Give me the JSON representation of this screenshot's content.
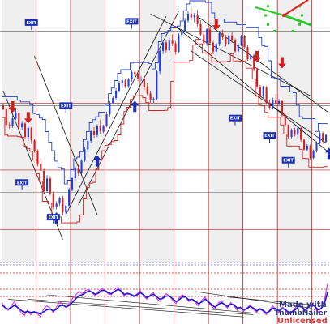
{
  "chart_data": {
    "type": "candlestick",
    "title": "",
    "xlabel": "",
    "ylabel": "",
    "grid": true,
    "panels": {
      "price": {
        "ylim": [
          0,
          100
        ]
      },
      "oscillator": {
        "ylim": [
          0,
          100
        ]
      }
    },
    "candles": [
      [
        60.0,
        60.6,
        58.2,
        58.8
      ],
      [
        58.8,
        59.2,
        51.1,
        52.2
      ],
      [
        52.2,
        53.2,
        50.7,
        51.7
      ],
      [
        51.7,
        56.1,
        51.0,
        54.8
      ],
      [
        54.8,
        58.5,
        54.2,
        57.2
      ],
      [
        57.2,
        57.4,
        50.5,
        51.3
      ],
      [
        51.3,
        53.8,
        50.3,
        52.8
      ],
      [
        52.8,
        53.4,
        46.6,
        47.4
      ],
      [
        47.4,
        52.0,
        45.7,
        51.1
      ],
      [
        51.1,
        51.4,
        44.6,
        46.0
      ],
      [
        46.0,
        46.5,
        41.0,
        41.8
      ],
      [
        41.8,
        42.3,
        35.5,
        36.5
      ],
      [
        36.5,
        38.8,
        32.6,
        33.7
      ],
      [
        33.7,
        34.6,
        24.4,
        25.5
      ],
      [
        25.5,
        32.0,
        24.9,
        30.6
      ],
      [
        30.6,
        31.4,
        23.7,
        24.6
      ],
      [
        24.6,
        25.4,
        18.2,
        19.0
      ],
      [
        19.0,
        21.4,
        18.1,
        20.5
      ],
      [
        20.5,
        23.3,
        19.6,
        22.7
      ],
      [
        22.7,
        23.6,
        15.7,
        16.9
      ],
      [
        16.9,
        20.3,
        16.1,
        19.7
      ],
      [
        19.7,
        26.9,
        18.9,
        26.3
      ],
      [
        26.3,
        31.2,
        25.4,
        30.7
      ],
      [
        30.7,
        35.6,
        29.9,
        34.7
      ],
      [
        34.7,
        36.2,
        31.7,
        33.0
      ],
      [
        33.0,
        38.4,
        32.1,
        37.8
      ],
      [
        37.8,
        43.3,
        37.3,
        42.4
      ],
      [
        42.4,
        46.5,
        41.0,
        45.8
      ],
      [
        45.8,
        50.1,
        44.8,
        49.7
      ],
      [
        49.7,
        51.3,
        47.0,
        48.1
      ],
      [
        48.1,
        52.5,
        47.3,
        51.9
      ],
      [
        51.9,
        54.4,
        48.5,
        49.5
      ],
      [
        49.5,
        52.3,
        48.9,
        51.8
      ],
      [
        51.8,
        57.5,
        51.2,
        56.5
      ],
      [
        56.5,
        61.8,
        55.6,
        61.0
      ],
      [
        61.0,
        64.1,
        60.6,
        63.1
      ],
      [
        63.1,
        67.1,
        62.3,
        66.0
      ],
      [
        66.0,
        70.0,
        65.5,
        69.0
      ],
      [
        69.0,
        71.5,
        67.0,
        70.2
      ],
      [
        70.2,
        70.8,
        67.0,
        67.8
      ],
      [
        67.8,
        71.2,
        67.1,
        70.6
      ],
      [
        70.6,
        74.2,
        69.7,
        73.5
      ],
      [
        73.5,
        74.4,
        71.9,
        72.8
      ],
      [
        72.8,
        74.0,
        69.8,
        70.7
      ],
      [
        70.7,
        71.8,
        69.8,
        70.9
      ],
      [
        70.9,
        71.7,
        66.2,
        67.3
      ],
      [
        67.3,
        69.1,
        64.2,
        64.9
      ],
      [
        64.9,
        66.0,
        61.0,
        62.2
      ],
      [
        62.2,
        63.3,
        61.1,
        62.8
      ],
      [
        62.8,
        74.3,
        62.2,
        73.8
      ],
      [
        73.8,
        82.8,
        72.8,
        82.1
      ],
      [
        82.1,
        86.1,
        80.8,
        85.5
      ],
      [
        85.5,
        86.3,
        81.4,
        82.3
      ],
      [
        82.3,
        87.3,
        81.6,
        86.2
      ],
      [
        86.2,
        88.7,
        84.0,
        85.1
      ],
      [
        85.1,
        86.0,
        80.5,
        81.7
      ],
      [
        81.7,
        89.1,
        81.3,
        88.5
      ],
      [
        88.5,
        91.1,
        87.4,
        90.2
      ],
      [
        90.2,
        95.3,
        89.7,
        94.3
      ],
      [
        94.3,
        98.0,
        93.4,
        97.1
      ],
      [
        97.1,
        99.3,
        94.3,
        95.6
      ],
      [
        95.6,
        97.3,
        93.6,
        96.6
      ],
      [
        96.6,
        98.6,
        91.9,
        92.9
      ],
      [
        92.9,
        94.4,
        87.9,
        88.7
      ],
      [
        88.7,
        89.5,
        84.3,
        85.1
      ],
      [
        85.1,
        91.4,
        84.1,
        90.8
      ],
      [
        90.8,
        91.9,
        84.7,
        85.4
      ],
      [
        85.4,
        86.1,
        80.7,
        81.8
      ],
      [
        81.8,
        85.5,
        80.9,
        84.9
      ],
      [
        84.9,
        90.2,
        84.0,
        89.2
      ],
      [
        89.2,
        90.7,
        86.4,
        87.6
      ],
      [
        87.6,
        88.6,
        83.9,
        84.9
      ],
      [
        84.9,
        89.3,
        84.3,
        88.3
      ],
      [
        88.3,
        89.6,
        85.4,
        86.6
      ],
      [
        86.6,
        87.1,
        81.0,
        81.9
      ],
      [
        81.9,
        85.2,
        81.2,
        84.6
      ],
      [
        84.6,
        88.6,
        83.9,
        87.9
      ],
      [
        87.9,
        88.6,
        82.7,
        83.6
      ],
      [
        83.6,
        84.4,
        78.1,
        78.7
      ],
      [
        78.7,
        81.2,
        78.1,
        80.3
      ],
      [
        80.3,
        80.9,
        73.7,
        74.7
      ],
      [
        74.7,
        75.1,
        66.8,
        67.7
      ],
      [
        67.7,
        68.3,
        63.2,
        63.8
      ],
      [
        63.8,
        68.1,
        62.9,
        67.3
      ],
      [
        67.3,
        67.9,
        60.3,
        61.1
      ],
      [
        61.1,
        62.4,
        58.3,
        59.2
      ],
      [
        59.2,
        63.2,
        58.4,
        62.3
      ],
      [
        62.3,
        64.8,
        59.9,
        60.7
      ],
      [
        60.7,
        62.6,
        60.1,
        61.8
      ],
      [
        61.8,
        62.2,
        55.2,
        56.1
      ],
      [
        56.1,
        57.2,
        51.5,
        52.2
      ],
      [
        52.2,
        52.5,
        46.7,
        47.4
      ],
      [
        47.4,
        50.8,
        46.8,
        50.2
      ],
      [
        50.2,
        51.1,
        47.6,
        48.2
      ],
      [
        48.2,
        51.5,
        47.5,
        51.0
      ],
      [
        51.0,
        51.7,
        45.4,
        46.2
      ],
      [
        46.2,
        46.6,
        41.7,
        42.3
      ],
      [
        42.3,
        44.4,
        41.6,
        43.8
      ],
      [
        43.8,
        44.3,
        38.2,
        38.9
      ],
      [
        38.9,
        42.3,
        38.4,
        41.7
      ],
      [
        41.7,
        45.6,
        41.0,
        44.9
      ],
      [
        44.9,
        49.8,
        44.4,
        48.9
      ],
      [
        48.9,
        49.5,
        44.5,
        45.5
      ],
      [
        45.5,
        48.6,
        45.0,
        48.1
      ]
    ],
    "oscillator": {
      "magenta": [
        36,
        28,
        22,
        30,
        38,
        26,
        18,
        12,
        22,
        14,
        20,
        16,
        10,
        24,
        30,
        26,
        18,
        28,
        38,
        32,
        26,
        34,
        44,
        50,
        56,
        52,
        58,
        60,
        54,
        48,
        56,
        62,
        58,
        52,
        50,
        60,
        64,
        56,
        48,
        54,
        50,
        46,
        52,
        58,
        48,
        42,
        50,
        54,
        44,
        38,
        46,
        52,
        48,
        40,
        34,
        44,
        50,
        46,
        38,
        42,
        36,
        30,
        40,
        46,
        36,
        30,
        24,
        34,
        40,
        32,
        26,
        36,
        30,
        22,
        28,
        20,
        26,
        32,
        24,
        18,
        26,
        20,
        14,
        22,
        30,
        24,
        18,
        28,
        22,
        14,
        20,
        26,
        34,
        28,
        20,
        30,
        36,
        28,
        18,
        26,
        40,
        70
      ],
      "blue": [
        32,
        27,
        24,
        27,
        31,
        27,
        22,
        18,
        20,
        18,
        19,
        18,
        15,
        19,
        23,
        24,
        21,
        24,
        30,
        31,
        28,
        31,
        37,
        43,
        49,
        50,
        54,
        57,
        55,
        51,
        53,
        58,
        58,
        54,
        52,
        56,
        60,
        57,
        51,
        52,
        51,
        48,
        50,
        54,
        50,
        45,
        48,
        51,
        47,
        42,
        44,
        48,
        48,
        43,
        38,
        41,
        46,
        46,
        41,
        42,
        39,
        34,
        37,
        42,
        38,
        33,
        28,
        31,
        36,
        33,
        29,
        33,
        32,
        26,
        27,
        23,
        25,
        29,
        26,
        21,
        24,
        22,
        17,
        20,
        26,
        25,
        21,
        25,
        23,
        18,
        19,
        23,
        29,
        28,
        23,
        27,
        32,
        30,
        23,
        25,
        33,
        55
      ]
    },
    "signals": [
      {
        "type": "arrow-down",
        "bar": 3,
        "price": 57.2
      },
      {
        "type": "arrow-down",
        "bar": 8,
        "price": 52.8
      },
      {
        "type": "arrow-up",
        "bar": 17,
        "price": 17.0
      },
      {
        "type": "arrow-up",
        "bar": 30,
        "price": 40.0
      },
      {
        "type": "arrow-up",
        "bar": 42,
        "price": 62.0
      },
      {
        "type": "arrow-down",
        "bar": 68,
        "price": 90.5
      },
      {
        "type": "arrow-down",
        "bar": 81,
        "price": 77.5
      },
      {
        "type": "arrow-down",
        "bar": 89,
        "price": 75.0
      },
      {
        "type": "arrow-up",
        "bar": 104,
        "price": 43.0
      }
    ],
    "labels": [
      {
        "text": "EXIT",
        "bar": 9,
        "price": 93.5
      },
      {
        "text": "EXIT",
        "bar": 20,
        "price": 60.0
      },
      {
        "text": "EXIT",
        "bar": 41,
        "price": 94.0
      },
      {
        "text": "EXIT",
        "bar": 6,
        "price": 29.0
      },
      {
        "text": "EXIT",
        "bar": 16,
        "price": 15.0
      },
      {
        "text": "EXIT",
        "bar": 74,
        "price": 55.0
      },
      {
        "text": "EXIT",
        "bar": 85,
        "price": 48.0
      },
      {
        "text": "EXIT",
        "bar": 91,
        "price": 38.0
      }
    ]
  },
  "watermark": {
    "line1": "Made with",
    "line2": "ThumbNailer",
    "line3": "Unlicensed"
  },
  "colors": {
    "bull": "#1f3fd8",
    "bear": "#d41f1f",
    "envelope": "#1f3fd8",
    "stops": "#d41f1f",
    "grid_vertical": "#b52222",
    "arrow_up": "#1b2fb5",
    "arrow_down": "#d41f1f",
    "oscillator_fast": "#e12fe0",
    "oscillator_slow": "#1a1ad8",
    "clock_hour": "#e22222",
    "clock_minute": "#27c92a",
    "clock_ticks": "#27c92a"
  }
}
